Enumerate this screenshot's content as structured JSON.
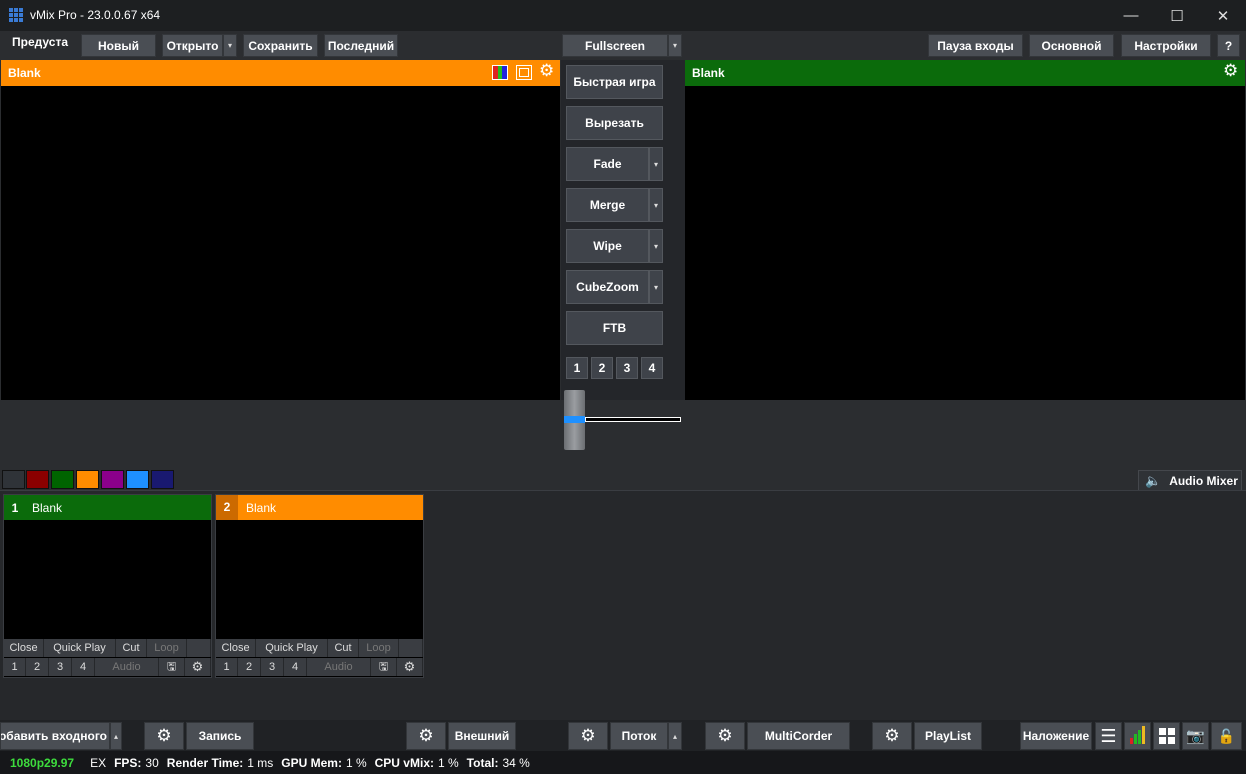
{
  "app": {
    "title": "vMix Pro - 23.0.0.67 x64"
  },
  "toolbar": {
    "preview_label": "Предуста",
    "new": "Новый",
    "open": "Открыто",
    "save": "Сохранить",
    "last": "Последний",
    "fullscreen": "Fullscreen",
    "pause_inputs": "Пауза входы",
    "main": "Основной",
    "settings": "Настройки",
    "help": "?"
  },
  "preview": {
    "title": "Blank",
    "color": "#ff8c00"
  },
  "output": {
    "title": "Blank",
    "color": "#0b6b0b"
  },
  "transitions": {
    "quick_play": "Быстрая игра",
    "cut": "Вырезать",
    "items": [
      "Fade",
      "Merge",
      "Wipe",
      "CubeZoom"
    ],
    "ftb": "FTB",
    "numbers": [
      "1",
      "2",
      "3",
      "4"
    ],
    "tbar_position": 0
  },
  "color_tags": [
    "#2f3338",
    "#8b0000",
    "#006400",
    "#ff8c00",
    "#8b008b",
    "#1e90ff",
    "#191970"
  ],
  "audio_mixer": {
    "label": "Audio Mixer"
  },
  "inputs": [
    {
      "number": "1",
      "title": "Blank",
      "color": "#0b6b0b",
      "state": "program",
      "close": "Close",
      "quick_play": "Quick Play",
      "cut": "Cut",
      "loop": "Loop",
      "nums": [
        "1",
        "2",
        "3",
        "4"
      ],
      "audio": "Audio"
    },
    {
      "number": "2",
      "title": "Blank",
      "color": "#ff8c00",
      "state": "preview",
      "close": "Close",
      "quick_play": "Quick Play",
      "cut": "Cut",
      "loop": "Loop",
      "nums": [
        "1",
        "2",
        "3",
        "4"
      ],
      "audio": "Audio"
    }
  ],
  "bottom": {
    "add_input": "Добавить входного",
    "record": "Запись",
    "external": "Внешний",
    "stream": "Поток",
    "multicorder": "MultiCorder",
    "playlist": "PlayList",
    "overlay": "Наложение"
  },
  "status": {
    "format": "1080p29.97",
    "ex": "EX",
    "fps_label": "FPS:",
    "fps": "30",
    "render_label": "Render Time:",
    "render": "1 ms",
    "gpu_label": "GPU Mem:",
    "gpu": "1 %",
    "cpu_label": "CPU vMix:",
    "cpu": "1 %",
    "total_label": "Total:",
    "total": "34 %"
  }
}
